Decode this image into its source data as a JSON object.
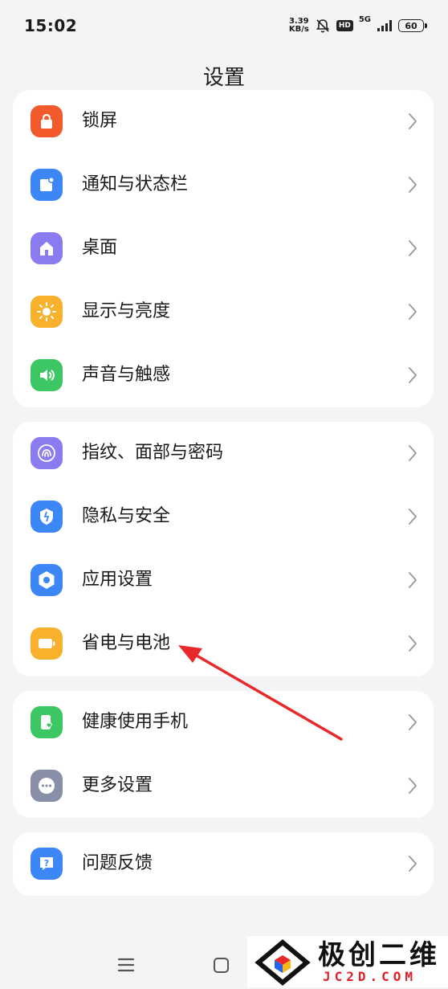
{
  "status_bar": {
    "time": "15:02",
    "speed_value": "3.39",
    "speed_unit": "KB/s",
    "hd": "HD",
    "network": "5G",
    "battery": "60"
  },
  "header": {
    "title": "设置"
  },
  "groups": [
    {
      "items": [
        {
          "label": "锁屏",
          "icon": "lock-icon",
          "color": "#F25A2C"
        },
        {
          "label": "通知与状态栏",
          "icon": "notification-icon",
          "color": "#3D86F5"
        },
        {
          "label": "桌面",
          "icon": "home-icon",
          "color": "#8B7BF0"
        },
        {
          "label": "显示与亮度",
          "icon": "sun-icon",
          "color": "#F8B12C"
        },
        {
          "label": "声音与触感",
          "icon": "speaker-icon",
          "color": "#3CC764"
        }
      ]
    },
    {
      "items": [
        {
          "label": "指纹、面部与密码",
          "icon": "fingerprint-icon",
          "color": "#8B7BF0"
        },
        {
          "label": "隐私与安全",
          "icon": "shield-icon",
          "color": "#3D86F5"
        },
        {
          "label": "应用设置",
          "icon": "hexagon-icon",
          "color": "#3D86F5"
        },
        {
          "label": "省电与电池",
          "icon": "battery-icon",
          "color": "#F8B12C"
        }
      ]
    },
    {
      "items": [
        {
          "label": "健康使用手机",
          "icon": "health-phone-icon",
          "color": "#3CC764"
        },
        {
          "label": "更多设置",
          "icon": "more-icon",
          "color": "#8A8FA8"
        }
      ]
    },
    {
      "items": [
        {
          "label": "问题反馈",
          "icon": "feedback-icon",
          "color": "#3D86F5"
        }
      ]
    }
  ],
  "annotation": {
    "color": "#E8282B"
  },
  "watermark": {
    "name": "极创二维",
    "url": "JC2D.COM"
  }
}
